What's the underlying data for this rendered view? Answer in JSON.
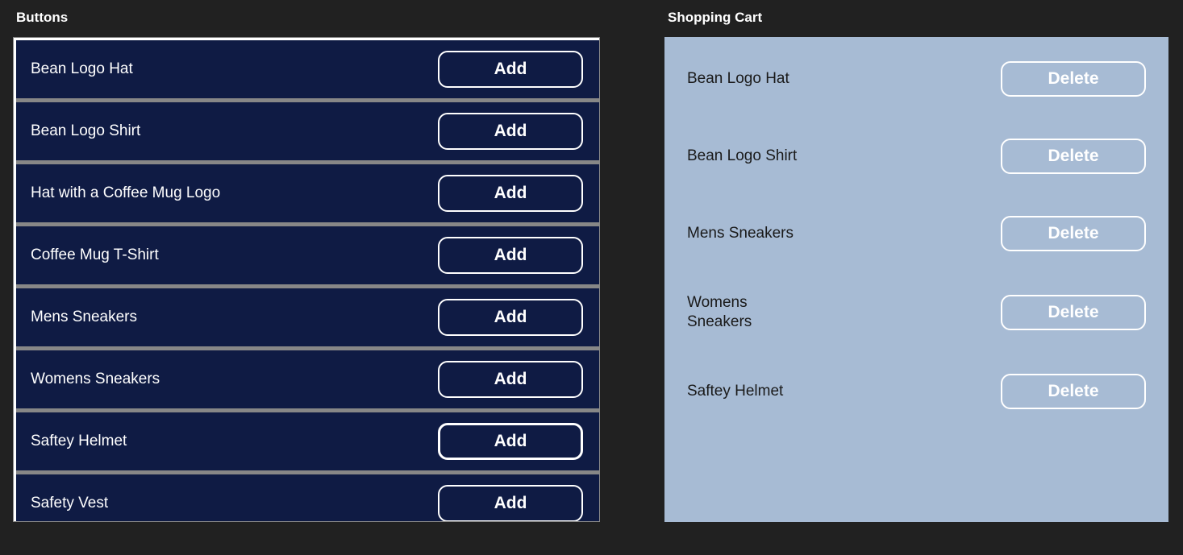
{
  "buttons_panel": {
    "title": "Buttons",
    "add_label": "Add",
    "items": [
      {
        "label": "Bean Logo Hat",
        "focused": false
      },
      {
        "label": "Bean Logo Shirt",
        "focused": false
      },
      {
        "label": "Hat with a Coffee Mug Logo",
        "focused": false
      },
      {
        "label": "Coffee Mug T-Shirt",
        "focused": false
      },
      {
        "label": "Mens Sneakers",
        "focused": false
      },
      {
        "label": "Womens Sneakers",
        "focused": false
      },
      {
        "label": "Saftey Helmet",
        "focused": true
      },
      {
        "label": "Safety Vest",
        "focused": false
      }
    ]
  },
  "cart_panel": {
    "title": "Shopping Cart",
    "delete_label": "Delete",
    "items": [
      {
        "label": "Bean Logo Hat"
      },
      {
        "label": "Bean Logo Shirt"
      },
      {
        "label": "Mens Sneakers"
      },
      {
        "label": "Womens Sneakers"
      },
      {
        "label": "Saftey Helmet"
      }
    ]
  }
}
